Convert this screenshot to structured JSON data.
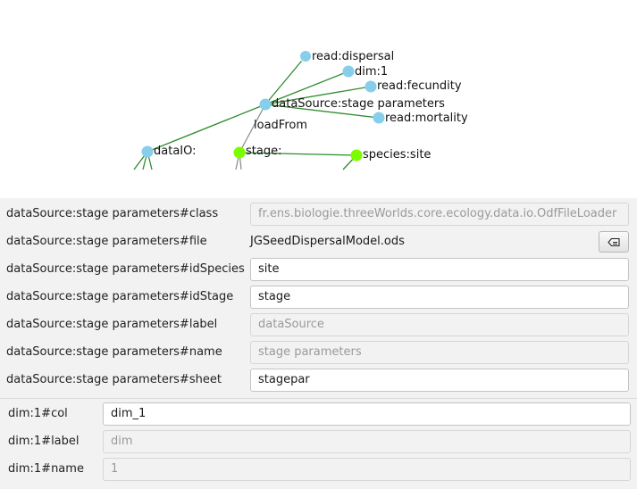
{
  "graph": {
    "nodes": [
      {
        "id": "read-dispersal",
        "label": "read:dispersal",
        "color": "#87ceeb"
      },
      {
        "id": "dim1",
        "label": "dim:1",
        "color": "#87ceeb"
      },
      {
        "id": "read-fecundity",
        "label": "read:fecundity",
        "color": "#87ceeb"
      },
      {
        "id": "datasource",
        "label": "dataSource:stage parameters",
        "color": "#87ceeb"
      },
      {
        "id": "read-mortality",
        "label": "read:mortality",
        "color": "#87ceeb"
      },
      {
        "id": "dataio",
        "label": "dataIO:",
        "color": "#87ceeb"
      },
      {
        "id": "stage",
        "label": "stage:",
        "color": "#7cfc00"
      },
      {
        "id": "species-site",
        "label": "species:site",
        "color": "#7cfc00"
      }
    ],
    "edge_label": "loadFrom",
    "edge_color": "#2e8b2e"
  },
  "properties": [
    {
      "label": "dataSource:stage parameters#class",
      "value": "fr.ens.biologie.threeWorlds.core.ecology.data.io.OdfFileLoader",
      "kind": "disabled"
    },
    {
      "label": "dataSource:stage parameters#file",
      "value": "JGSeedDispersalModel.ods",
      "kind": "file"
    },
    {
      "label": "dataSource:stage parameters#idSpecies",
      "value": "site",
      "kind": "editable"
    },
    {
      "label": "dataSource:stage parameters#idStage",
      "value": "stage",
      "kind": "editable"
    },
    {
      "label": "dataSource:stage parameters#label",
      "value": "dataSource",
      "kind": "disabled"
    },
    {
      "label": "dataSource:stage parameters#name",
      "value": "stage parameters",
      "kind": "disabled"
    },
    {
      "label": "dataSource:stage parameters#sheet",
      "value": "stagepar",
      "kind": "editable"
    }
  ],
  "dim_properties": [
    {
      "label": "dim:1#col",
      "value": "dim_1",
      "kind": "editable"
    },
    {
      "label": "dim:1#label",
      "value": "dim",
      "kind": "disabled"
    },
    {
      "label": "dim:1#name",
      "value": "1",
      "kind": "disabled"
    }
  ],
  "file_button_icon": "eraser-icon"
}
